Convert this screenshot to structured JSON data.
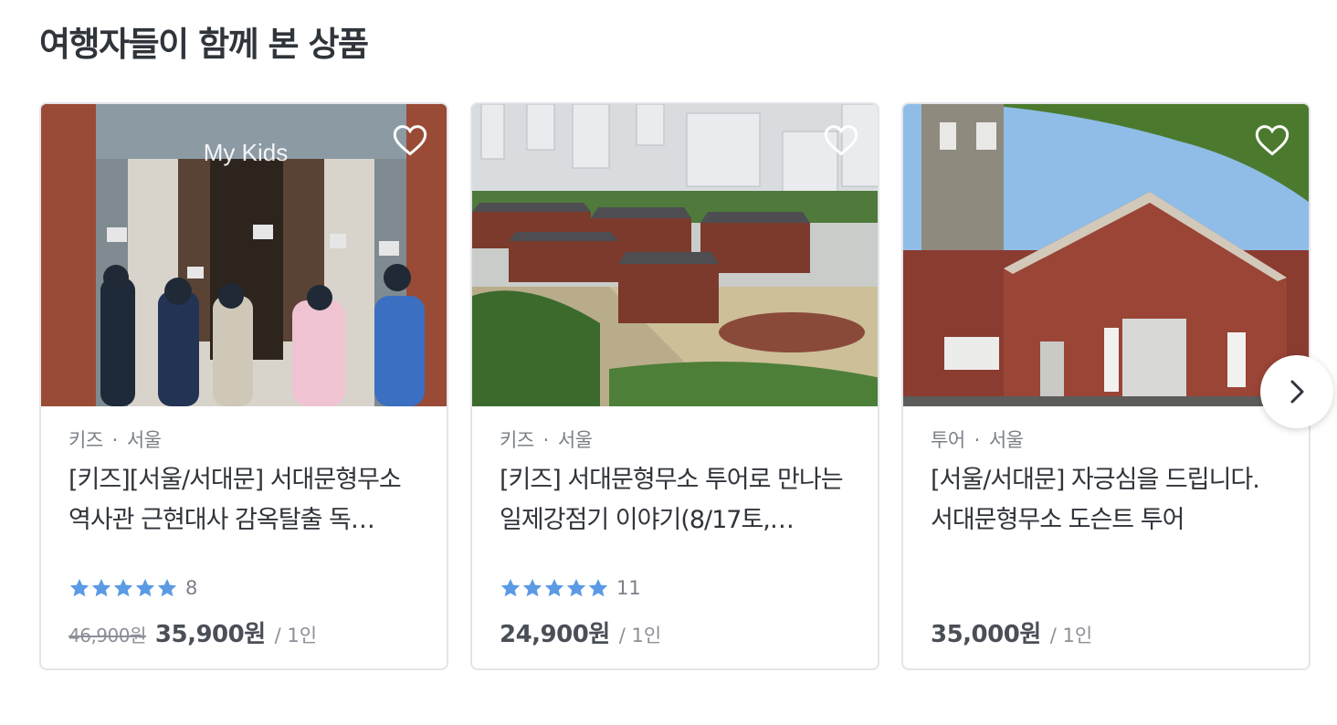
{
  "section": {
    "title": "여행자들이 함께 본 상품"
  },
  "cards": [
    {
      "category": "키즈",
      "location": "서울",
      "name": "[키즈][서울/서대문] 서대문형무소 역사관 근현대사 감옥탈출 독…",
      "rating": 5,
      "review_count": "8",
      "original_price": "46,900원",
      "price": "35,900원",
      "unit": "/ 1인",
      "image_watermark": "My Kids"
    },
    {
      "category": "키즈",
      "location": "서울",
      "name": "[키즈] 서대문형무소 투어로 만나는 일제강점기 이야기(8/17토,…",
      "rating": 5,
      "review_count": "11",
      "original_price": "",
      "price": "24,900원",
      "unit": "/ 1인"
    },
    {
      "category": "투어",
      "location": "서울",
      "name": "[서울/서대문] 자긍심을 드립니다. 서대문형무소 도슨트 투어",
      "rating": null,
      "review_count": "",
      "original_price": "",
      "price": "35,000원",
      "unit": "/ 1인"
    }
  ],
  "icons": {
    "wishlist": "heart-outline-icon",
    "next": "chevron-right-icon",
    "star": "star-icon"
  },
  "colors": {
    "star": "#5b9be5",
    "title": "#30343b",
    "muted": "#7b8089",
    "border": "#e2e5e9"
  }
}
